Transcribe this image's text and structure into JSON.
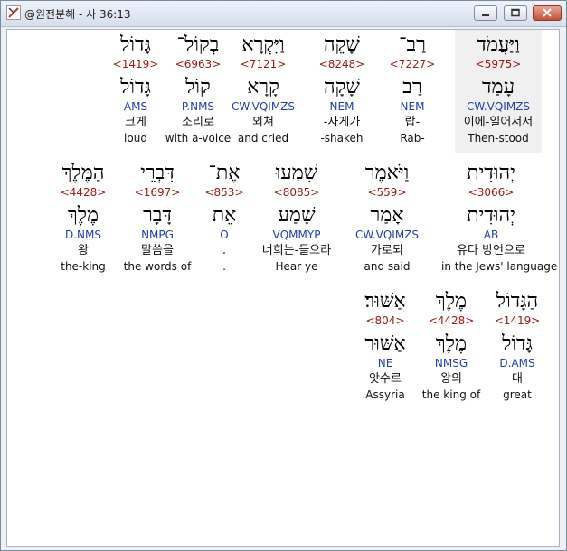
{
  "window": {
    "title": "@원전분해 - 사 36:13"
  },
  "rows": [
    [
      {
        "heb": "וַיַּעֲמֹד",
        "num": "<5975>",
        "lex": "עָמַד",
        "morph": "CW.VQIMZS",
        "kor": "이에-일어서서",
        "eng": "Then-stood",
        "selected": true
      },
      {
        "heb": "רַב־",
        "num": "<7227>",
        "lex": "רַב",
        "morph": "NEM",
        "kor": "랍-",
        "eng": "Rab-"
      },
      {
        "heb": "שָׁקֵה",
        "num": "<8248>",
        "lex": "שָׁקָה",
        "morph": "NEM",
        "kor": "-사게가",
        "eng": "-shakeh"
      },
      {
        "heb": "וַיִּקְרָא",
        "num": "<7121>",
        "lex": "קָרָא",
        "morph": "CW.VQIMZS",
        "kor": "외쳐",
        "eng": "and cried"
      },
      {
        "heb": "בְקוֹל־",
        "num": "<6963>",
        "lex": "קוֹל",
        "morph": "P.NMS",
        "kor": "소리로",
        "eng": "with a-voice"
      },
      {
        "heb": "גָּדוֹל",
        "num": "<1419>",
        "lex": "גָּדוֹל",
        "morph": "AMS",
        "kor": "크게",
        "eng": "loud"
      }
    ],
    [
      {
        "heb": "יְהוּדִית",
        "num": "<3066>",
        "lex": "יְהוּדִית",
        "morph": "AB",
        "kor": "유다 방언으로",
        "eng": "in the Jews' language"
      },
      {
        "heb": "וַיֹּאמֶר",
        "num": "<559>",
        "lex": "אָמַר",
        "morph": "CW.VQIMZS",
        "kor": "가로되",
        "eng": "and said"
      },
      {
        "heb": "שִׁמְעוּ",
        "num": "<8085>",
        "lex": "שָׁמַע",
        "morph": "VQMMYP",
        "kor": "너희는-들으라",
        "eng": "Hear ye"
      },
      {
        "heb": "אֶת־",
        "num": "<853>",
        "lex": "אֵת",
        "morph": "O",
        "kor": ".",
        "eng": "."
      },
      {
        "heb": "דִּבְרֵי",
        "num": "<1697>",
        "lex": "דָּבָר",
        "morph": "NMPG",
        "kor": "말씀을",
        "eng": "the words of"
      },
      {
        "heb": "הַמֶּלֶךְ",
        "num": "<4428>",
        "lex": "מֶלֶךְ",
        "morph": "D.NMS",
        "kor": "왕",
        "eng": "the-king"
      }
    ],
    [
      {
        "heb": "הַגָּדוֹל",
        "num": "<1419>",
        "lex": "גָּדוֹל",
        "morph": "D.AMS",
        "kor": "대",
        "eng": "great"
      },
      {
        "heb": "מֶלֶךְ",
        "num": "<4428>",
        "lex": "מֶלֶךְ",
        "morph": "NMSG",
        "kor": "왕의",
        "eng": "the king of"
      },
      {
        "heb": "אַשּׁוּר׃",
        "num": "<804>",
        "lex": "אַשּׁוּר",
        "morph": "NE",
        "kor": "앗수르",
        "eng": "Assyria"
      }
    ]
  ]
}
